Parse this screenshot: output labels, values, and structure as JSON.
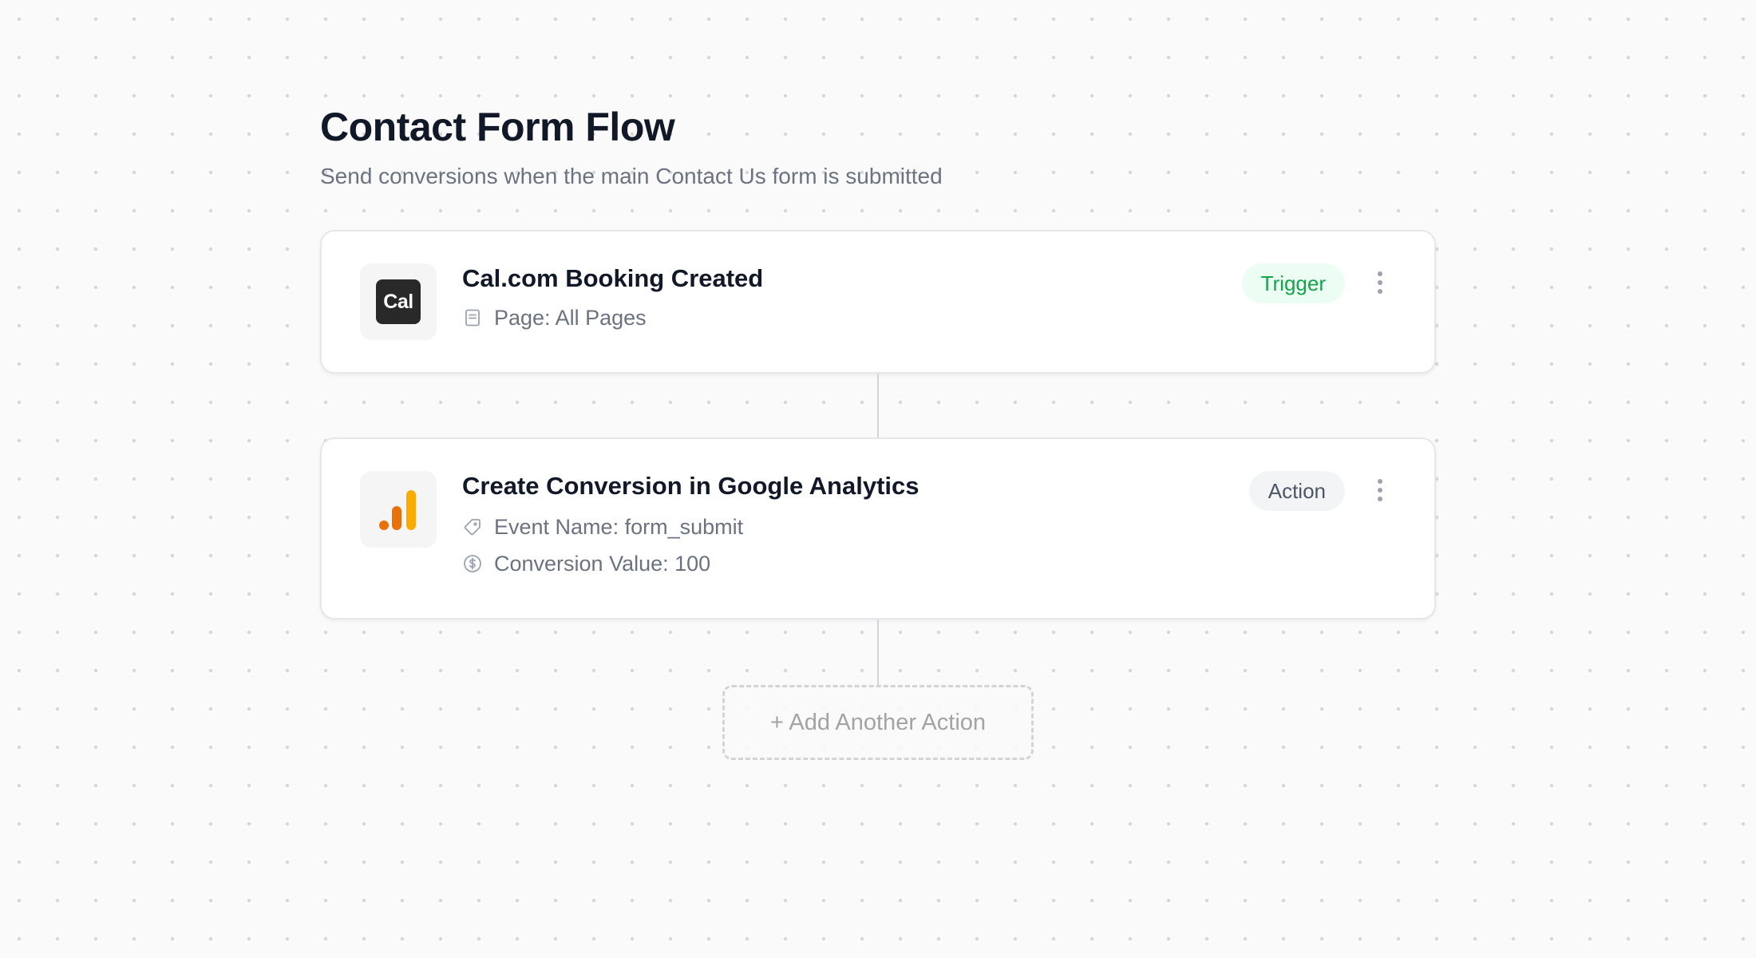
{
  "flow": {
    "title": "Contact Form Flow",
    "subtitle": "Send conversions when the main Contact Us form is submitted"
  },
  "trigger": {
    "logo_text": "Cal",
    "title": "Cal.com Booking Created",
    "meta": [
      {
        "icon": "page-icon",
        "text": "Page: All Pages"
      }
    ],
    "badge": "Trigger",
    "badge_color": "#16a34a",
    "badge_bg": "#ecfdf3"
  },
  "action": {
    "logo": "google-analytics-logo",
    "title": "Create Conversion in Google Analytics",
    "meta": [
      {
        "icon": "tag-icon",
        "text": "Event Name: form_submit"
      },
      {
        "icon": "dollar-circle-icon",
        "text": "Conversion Value: 100"
      }
    ],
    "badge": "Action",
    "logo_colors": [
      "#e8710a",
      "#f9ab00"
    ]
  },
  "add_action": {
    "label": "+ Add Another Action"
  }
}
